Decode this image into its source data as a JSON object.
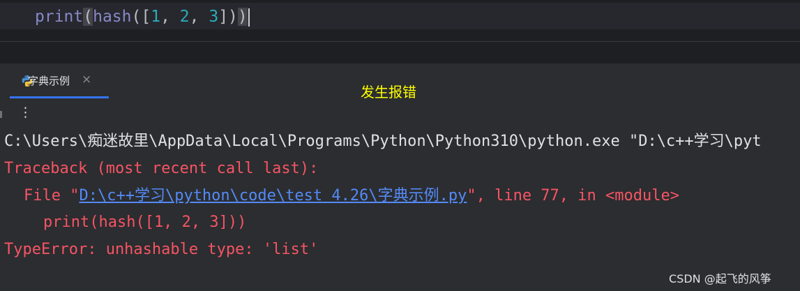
{
  "editor": {
    "code": {
      "func_print": "print",
      "open_paren_hl": "(",
      "func_hash": "hash",
      "open_paren": "(",
      "open_bracket": "[",
      "n1": "1",
      "sep1": ", ",
      "n2": "2",
      "sep2": ", ",
      "n3": "3",
      "close": "])",
      "close_paren_hl": ")"
    }
  },
  "tab": {
    "label": "字典示例",
    "close": "×",
    "icon": "python-icon"
  },
  "annotation": "发生报错",
  "toolbar": {
    "more_icon": "⋮"
  },
  "console": {
    "command": "C:\\Users\\痴迷故里\\AppData\\Local\\Programs\\Python\\Python310\\python.exe \"D:\\c++学习\\pyt",
    "traceback_header": "Traceback (most recent call last):",
    "file_prefix": "File \"",
    "file_link": "D:\\c++学习\\python\\code\\test 4.26\\字典示例.py",
    "file_suffix": "\", line 77, in <module>",
    "code_line": "print(hash([1, 2, 3]))",
    "error": "TypeError: unhashable type: 'list'"
  },
  "watermark": "CSDN @起飞的风筝",
  "colors": {
    "background": "#2b2d30",
    "error_red": "#f75464",
    "link_blue": "#548af7",
    "annotation_yellow": "#ffff00",
    "tab_accent": "#3574f0"
  }
}
